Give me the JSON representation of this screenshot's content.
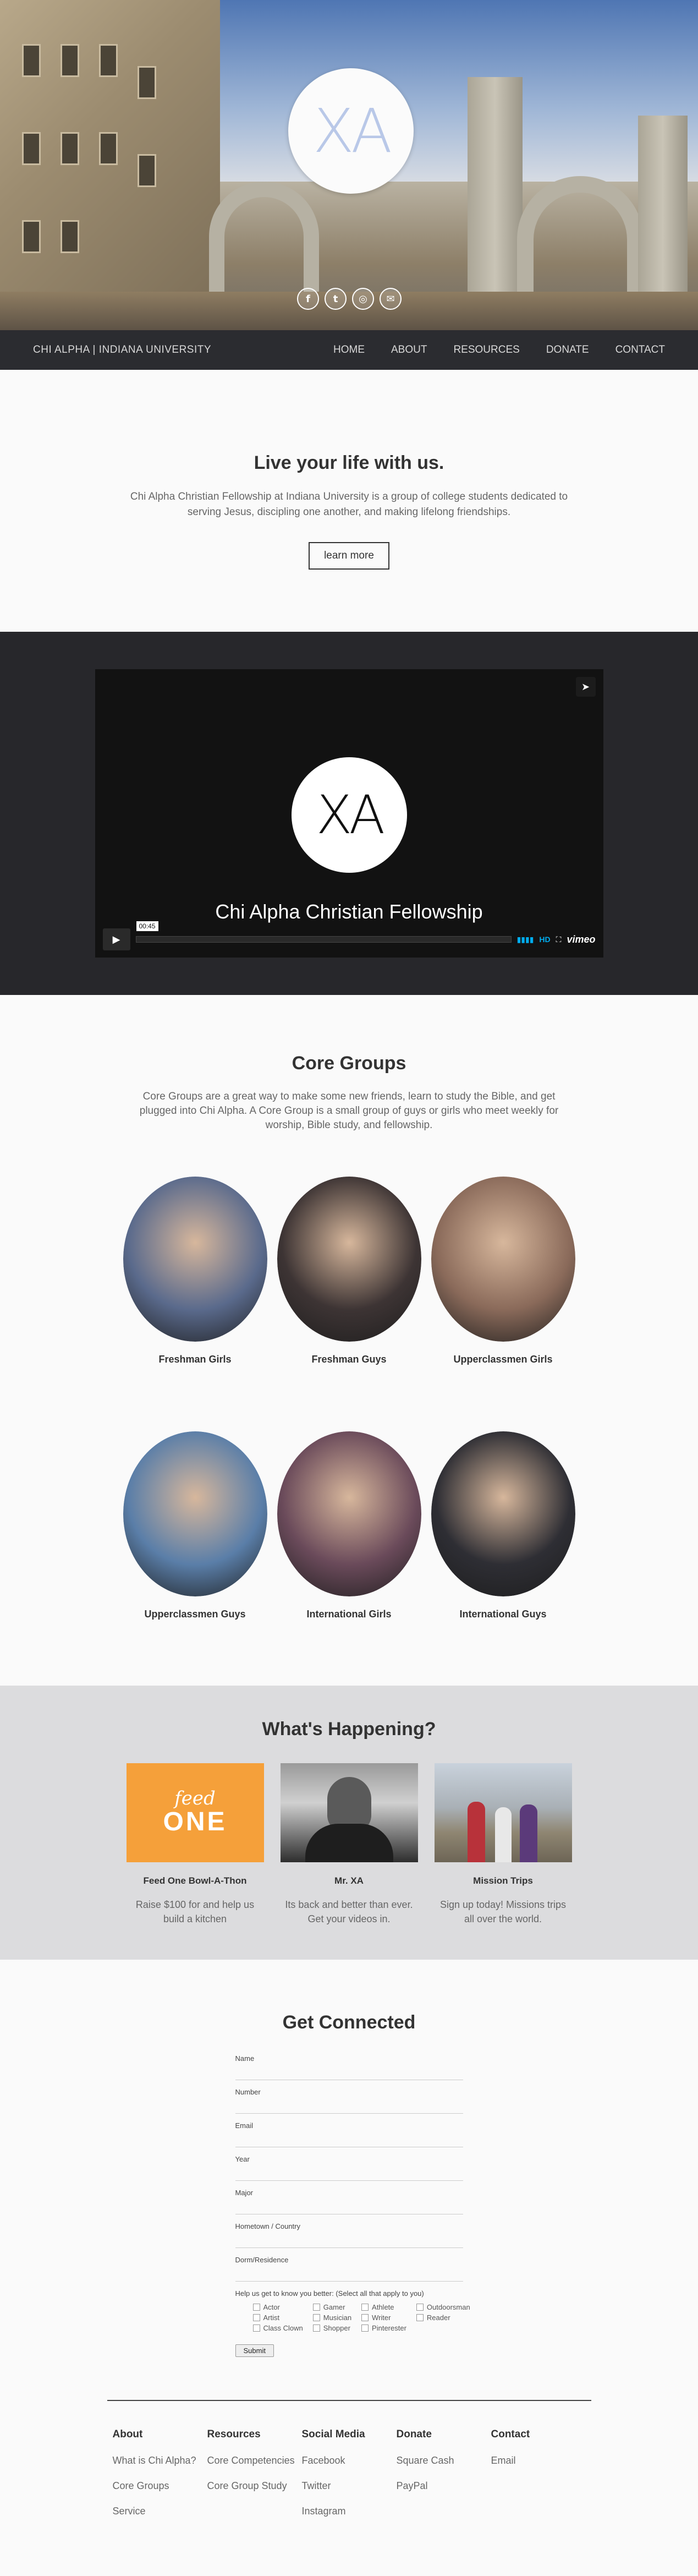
{
  "hero": {
    "logo_text": "XA",
    "social_icons": [
      "facebook-icon",
      "twitter-icon",
      "instagram-icon",
      "email-icon"
    ],
    "social_glyphs": [
      "f",
      "t",
      "◎",
      "✉"
    ]
  },
  "nav": {
    "brand": "CHI ALPHA | INDIANA UNIVERSITY",
    "links": [
      "HOME",
      "ABOUT",
      "RESOURCES",
      "DONATE",
      "CONTACT"
    ]
  },
  "intro": {
    "title": "Live your life with us.",
    "text": "Chi Alpha Christian Fellowship at Indiana University is a group of college students dedicated to serving Jesus, discipling one another, and making lifelong friendships.",
    "button": "learn more"
  },
  "video": {
    "logo_text": "XA",
    "title": "Chi Alpha Christian Fellowship",
    "duration": "00:45",
    "hd": "HD",
    "provider": "vimeo"
  },
  "core": {
    "title": "Core Groups",
    "text": "Core Groups are a great way to make some new friends, learn to study the Bible, and get plugged into Chi Alpha. A Core Group is a small group of guys or girls who meet weekly for worship, Bible study, and fellowship.",
    "groups": [
      {
        "name": "Freshman Girls",
        "color": "#5a6a8c"
      },
      {
        "name": "Freshman Guys",
        "color": "#3d3434"
      },
      {
        "name": "Upperclassmen Girls",
        "color": "#8a6a5a"
      },
      {
        "name": "Upperclassmen Guys",
        "color": "#5a7ea8"
      },
      {
        "name": "International Girls",
        "color": "#6a4a5a"
      },
      {
        "name": "International Guys",
        "color": "#2e2e34"
      }
    ]
  },
  "happening": {
    "title": "What's Happening?",
    "events": [
      {
        "title": "Feed One Bowl-A-Thon",
        "text": "Raise $100 for and help us build a kitchen",
        "thumb_top": "feed",
        "thumb_bottom": "ONE"
      },
      {
        "title": "Mr. XA",
        "text": "Its back and better than ever. Get your videos in."
      },
      {
        "title": "Mission Trips",
        "text": "Sign up today! Missions trips all over the world."
      }
    ]
  },
  "connect": {
    "title": "Get Connected",
    "fields": [
      "Name",
      "Number",
      "Email",
      "Year",
      "Major",
      "Hometown / Country",
      "Dorm/Residence"
    ],
    "checks_title": "Help us get to know you better: (Select all that apply to you)",
    "checks": [
      "Actor",
      "Gamer",
      "Athlete",
      "Outdoorsman",
      "Artist",
      "Musician",
      "Writer",
      "Reader",
      "Class Clown",
      "Shopper",
      "Pinterester"
    ],
    "submit": "Submit"
  },
  "footer": {
    "cols": [
      {
        "title": "About",
        "links": [
          "What is Chi Alpha?",
          "Core Groups",
          "Service"
        ]
      },
      {
        "title": "Resources",
        "links": [
          "Core Competencies",
          "Core Group Study"
        ]
      },
      {
        "title": "Social Media",
        "links": [
          "Facebook",
          "Twitter",
          "Instagram"
        ]
      },
      {
        "title": "Donate",
        "links": [
          "Square Cash",
          "PayPal"
        ]
      },
      {
        "title": "Contact",
        "links": [
          "Email"
        ]
      }
    ]
  }
}
